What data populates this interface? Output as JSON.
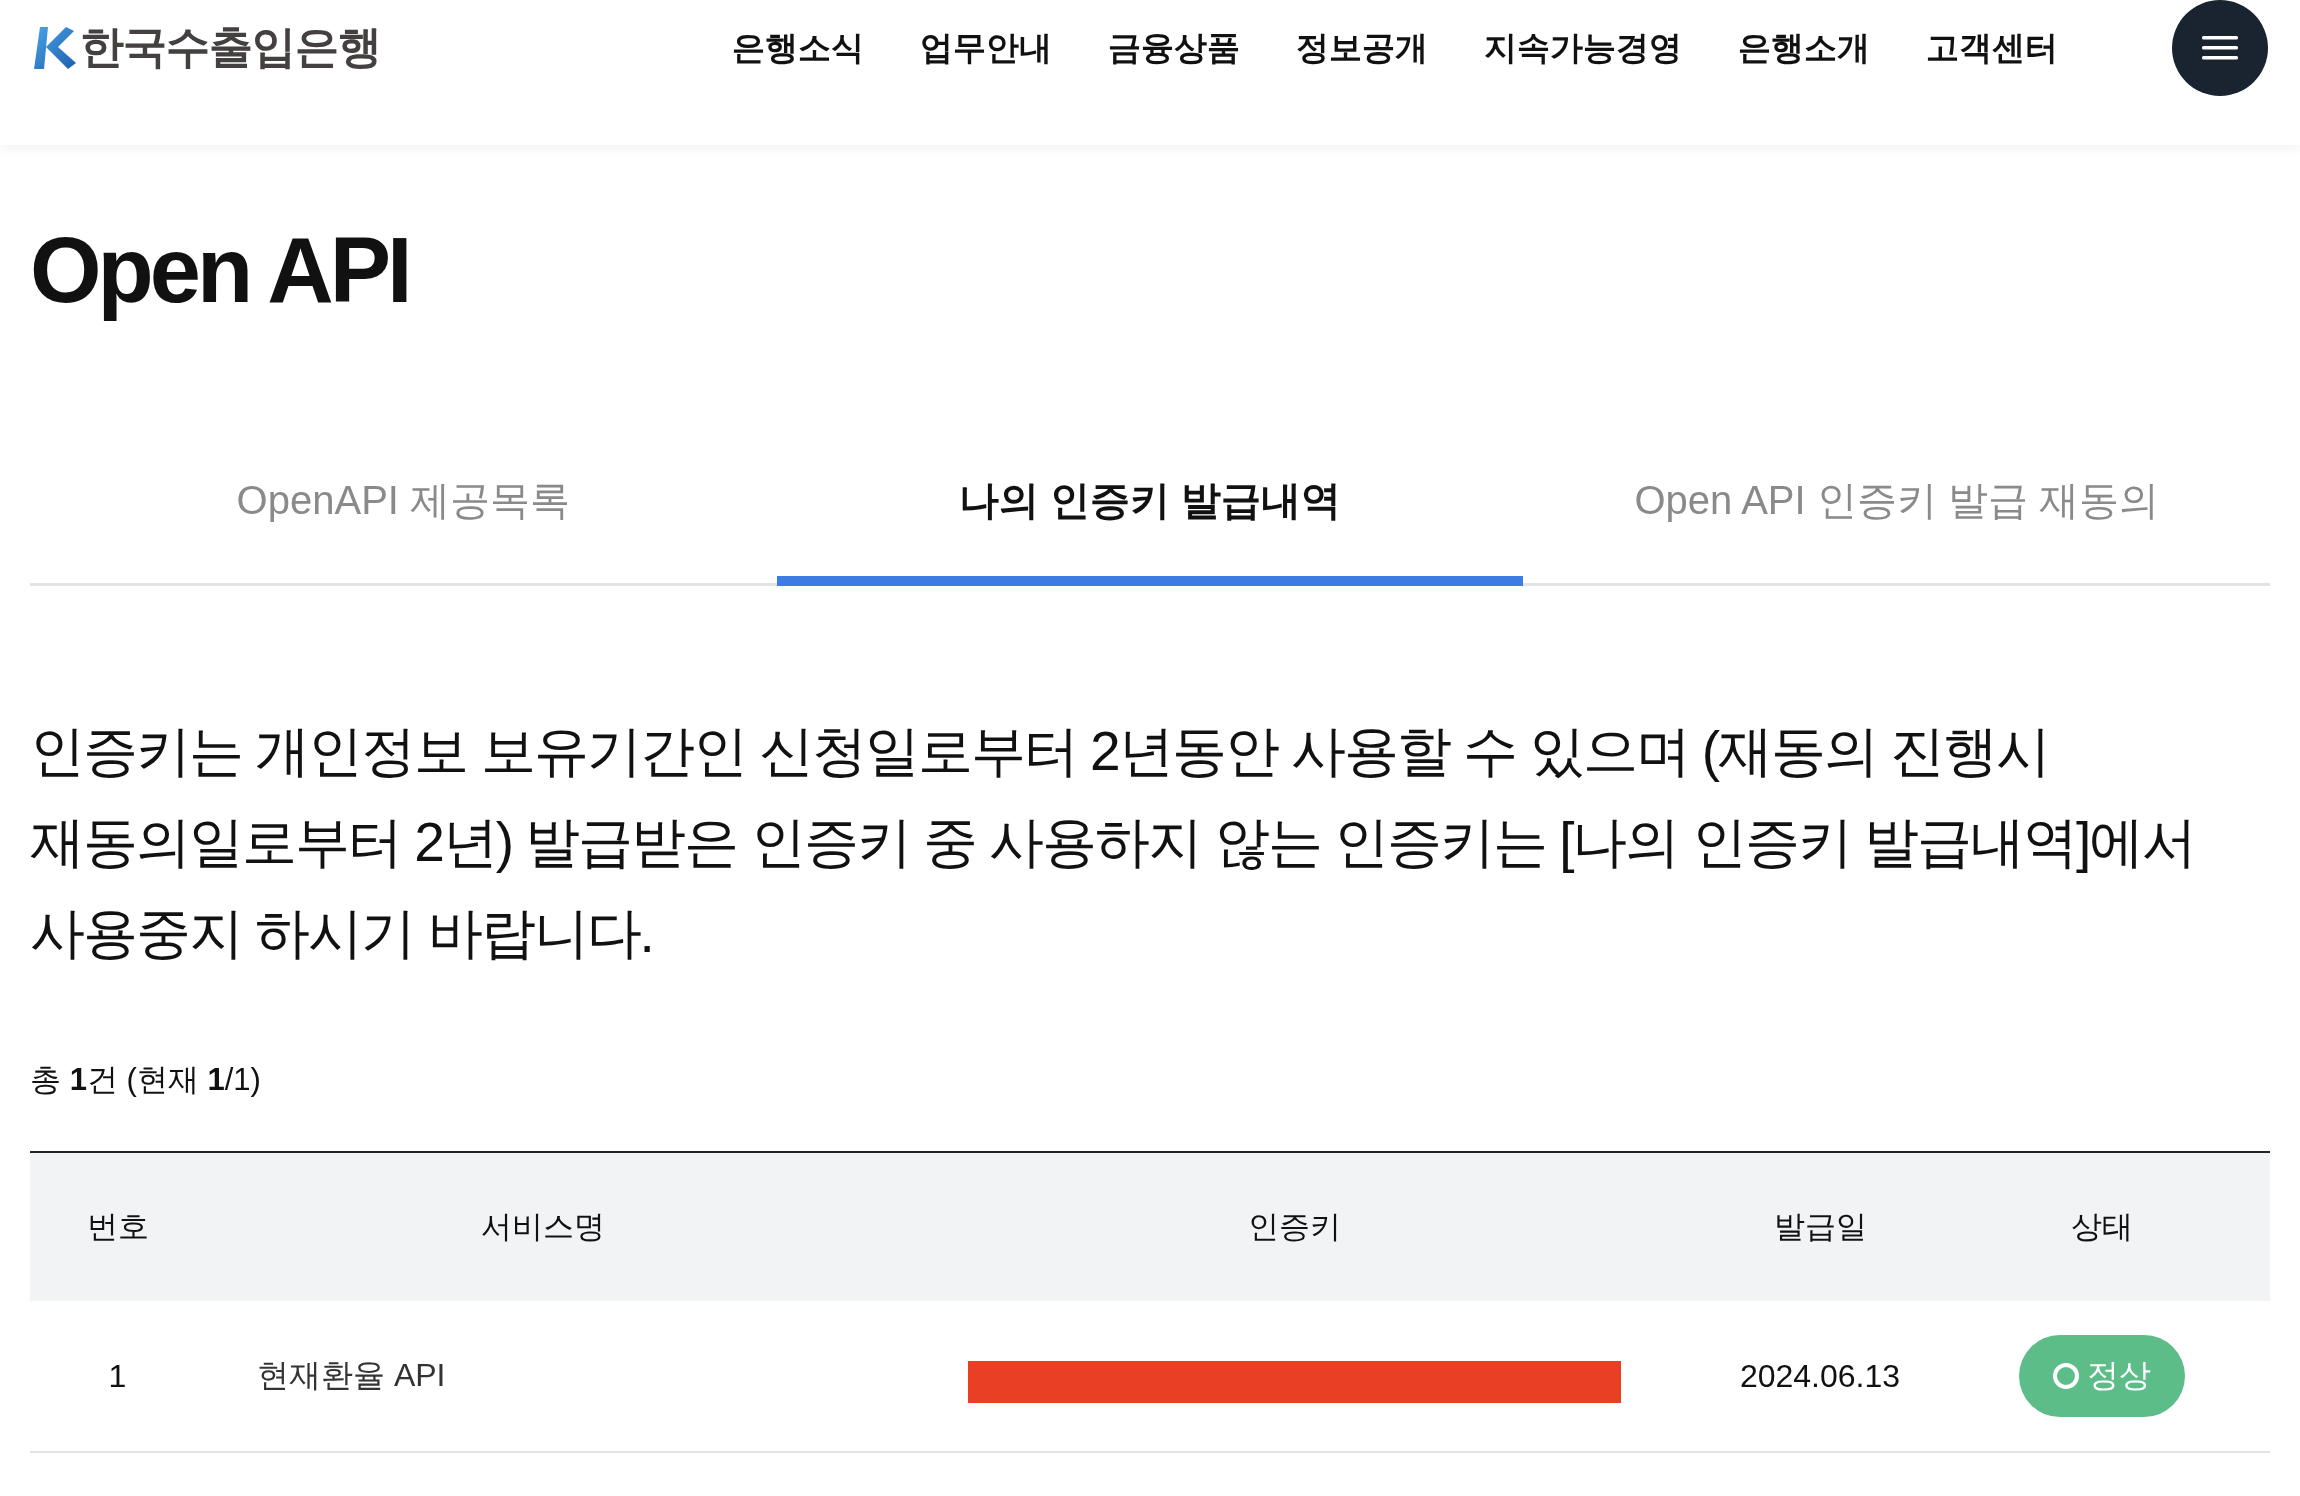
{
  "header": {
    "logo_text": "한국수출입은행",
    "nav": [
      "은행소식",
      "업무안내",
      "금융상품",
      "정보공개",
      "지속가능경영",
      "은행소개",
      "고객센터"
    ]
  },
  "page_title": "Open API",
  "tabs": [
    {
      "label": "OpenAPI 제공목록",
      "selected": false
    },
    {
      "label": "나의 인증키 발급내역",
      "selected": true
    },
    {
      "label": "Open API 인증키 발급 재동의",
      "selected": false
    }
  ],
  "notice": "인증키는 개인정보 보유기간인 신청일로부터 2년동안 사용할 수 있으며 (재동의 진행시 재동의일로부터 2년) 발급받은 인증키 중 사용하지 않는 인증키는 [나의 인증키 발급내역]에서 사용중지 하시기 바랍니다.",
  "count": "총 **1**건 (현재 **1**/1)",
  "table": {
    "columns": [
      "번호",
      "서비스명",
      "인증키",
      "발급일",
      "상태"
    ],
    "rows": [
      {
        "number": "1",
        "service": "현재환율 API",
        "key_redacted": true,
        "issued": "2024.06.13",
        "status": {
          "label": "정상",
          "kind": "normal"
        }
      }
    ]
  }
}
